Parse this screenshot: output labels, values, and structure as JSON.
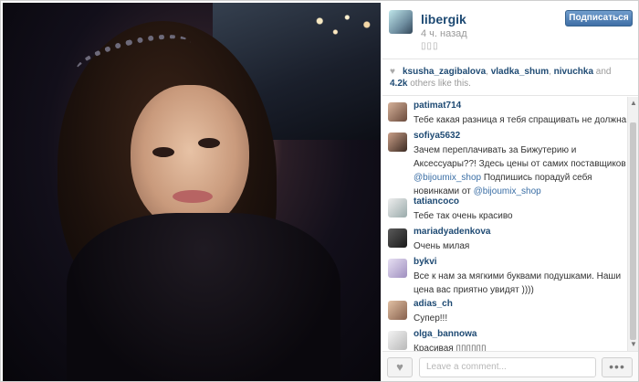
{
  "post": {
    "username": "libergik",
    "time_ago": "4 ч. назад",
    "location_glyphs": "▯▯▯",
    "follow_label": "Подписаться"
  },
  "likes": {
    "users": [
      "ksusha_zagibalova",
      "vladka_shum",
      "nivuchka"
    ],
    "count": "4.2k",
    "suffix": "others like this."
  },
  "comments": [
    {
      "user": "patimat714",
      "text": "Тебе какая разница я тебя спращивать не должна"
    },
    {
      "user": "sofiya5632",
      "text_parts": [
        "Зачем переплачивать за Бижутерию и Аксессуары??! Здесь цены от самих поставщиков ",
        "@bijoumix_shop",
        " Подпишись порадуй себя новинками от ",
        "@bijoumix_shop"
      ]
    },
    {
      "user": "tatiancoco",
      "text": "Тебе так очень красиво"
    },
    {
      "user": "mariadyadenkova",
      "text": "Очень милая"
    },
    {
      "user": "bykvi",
      "text": "Все к нам за мягкими буквами подушками. Наши цена вас приятно увидят ))))"
    },
    {
      "user": "adias_ch",
      "text": "Супер!!!"
    },
    {
      "user": "olga_bannowa",
      "text": "Красивая ▯▯▯▯▯▯"
    }
  ],
  "footer": {
    "comment_placeholder": "Leave a comment...",
    "more_label": "•••"
  },
  "colors": {
    "username": "#1e4a73",
    "follow_button": "#3f6fa6",
    "mention": "#3a6ea5"
  },
  "icons": {
    "like": "heart-icon",
    "more": "more-icon"
  }
}
